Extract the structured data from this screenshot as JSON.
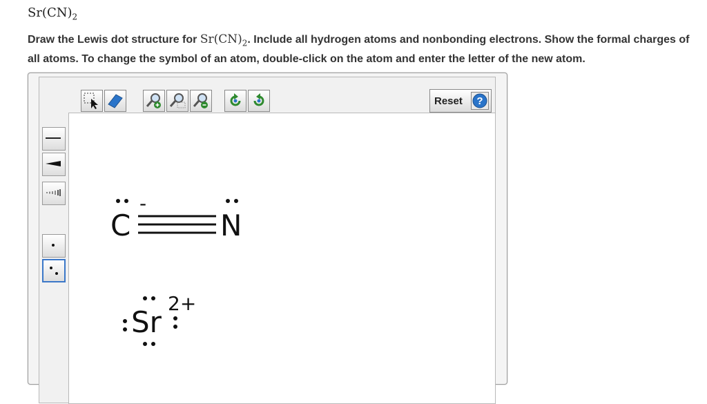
{
  "title": {
    "prefix": "Sr(CN)",
    "subscript": "2"
  },
  "instruction": {
    "part1": "Draw the Lewis dot structure for ",
    "formula_prefix": "Sr(CN)",
    "formula_subscript": "2",
    "part2": ". Include all hydrogen atoms and nonbonding electrons. Show the formal charges of all atoms. To change the symbol of an atom, double-click on the atom and enter the letter of the new atom."
  },
  "toolbar": {
    "reset_label": "Reset",
    "help_symbol": "?"
  },
  "molecule": {
    "atom_c": "C",
    "atom_n": "N",
    "atom_sr": "Sr",
    "charge_c": "-",
    "charge_sr": "2+"
  },
  "colors": {
    "accent": "#3a77c8",
    "icon_green": "#2f8a2f",
    "icon_blue": "#2a74c9"
  }
}
